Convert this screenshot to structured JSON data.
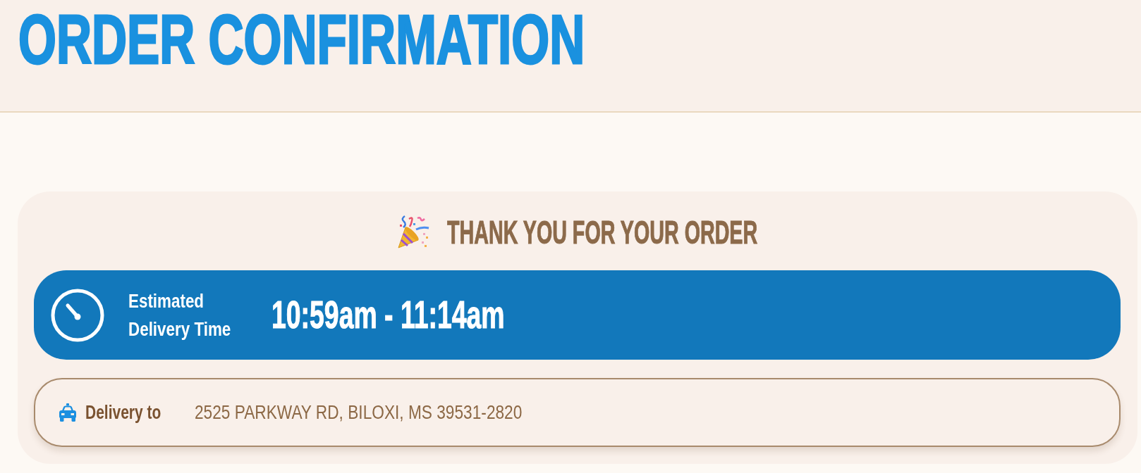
{
  "header": {
    "title": "ORDER CONFIRMATION"
  },
  "confirmation": {
    "heading": "THANK YOU FOR YOUR ORDER",
    "estimate": {
      "label": "Estimated Delivery Time",
      "time": "10:59am - 11:14am"
    },
    "delivery": {
      "label": "Delivery to",
      "address": "2525 PARKWAY RD, BILOXI, MS 39531-2820"
    }
  }
}
